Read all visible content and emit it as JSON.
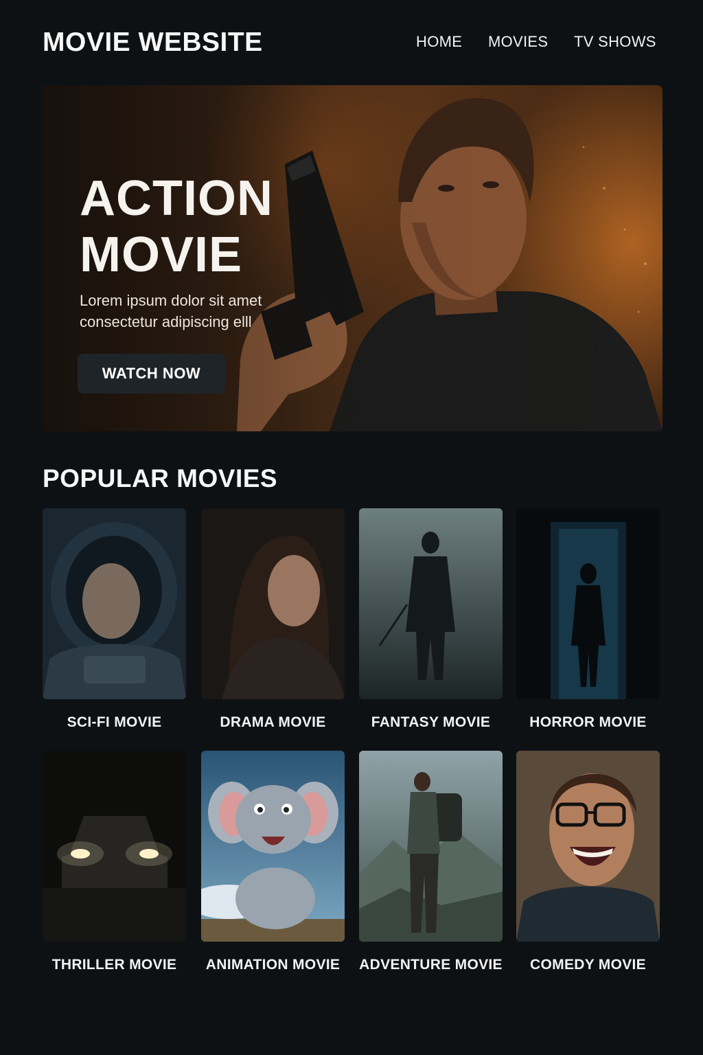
{
  "header": {
    "logo": "MOVIE WEBSITE",
    "nav": [
      {
        "label": "HOME"
      },
      {
        "label": "MOVIES"
      },
      {
        "label": "TV SHOWS"
      }
    ]
  },
  "hero": {
    "title_line1": "ACTION",
    "title_line2": "MOVIE",
    "description": "Lorem ipsum dolor sit amet consectetur adipiscing elll",
    "cta_label": "WATCH NOW"
  },
  "popular": {
    "title": "POPULAR MOVIES",
    "movies": [
      {
        "label": "SCI-FI MOVIE"
      },
      {
        "label": "DRAMA MOVIE"
      },
      {
        "label": "FANTASY MOVIE"
      },
      {
        "label": "HORROR MOVIE"
      },
      {
        "label": "THRILLER MOVIE"
      },
      {
        "label": "ANIMATION MOVIE"
      },
      {
        "label": "ADVENTURE MOVIE"
      },
      {
        "label": "COMEDY MOVIE"
      }
    ]
  },
  "colors": {
    "background": "#0e1114",
    "button": "#1f2429",
    "text": "#f2f2f2",
    "hero_glow": "#d67828"
  }
}
